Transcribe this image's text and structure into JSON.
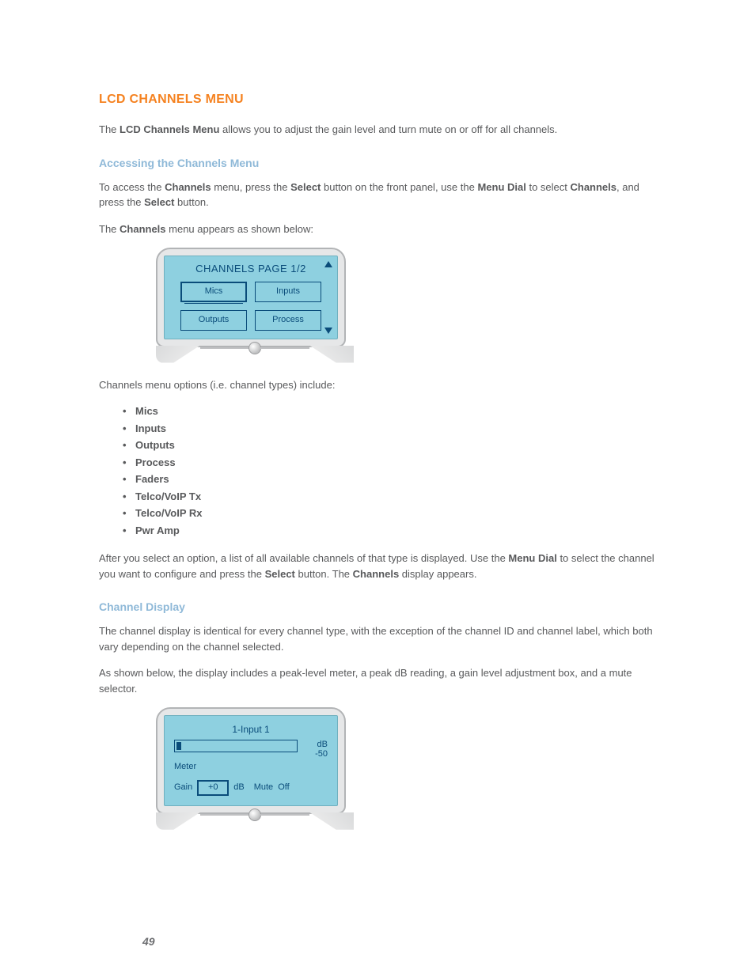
{
  "heading": "LCD CHANNELS MENU",
  "intro": {
    "pre": "The ",
    "bold": "LCD Channels Menu",
    "post": " allows you to adjust the gain level and turn mute on or off for all channels."
  },
  "section_access": {
    "title": "Accessing the Channels Menu",
    "p1": {
      "t0": "To access the ",
      "b1": "Channels",
      "t1": " menu, press the ",
      "b2": "Select",
      "t2": " button on the front panel, use the ",
      "b3": "Menu Dial",
      "t3": " to select ",
      "b4": "Channels",
      "t4": ", and press the ",
      "b5": "Select",
      "t5": " button."
    },
    "p2": {
      "t0": "The ",
      "b1": "Channels",
      "t1": " menu appears as shown below:"
    }
  },
  "lcd1": {
    "title": "CHANNELS PAGE 1/2",
    "buttons": [
      "Mics",
      "Inputs",
      "Outputs",
      "Process"
    ]
  },
  "options_intro": "Channels menu options (i.e. channel types) include:",
  "options": [
    "Mics",
    "Inputs",
    "Outputs",
    "Process",
    "Faders",
    "Telco/VoIP Tx",
    "Telco/VoIP Rx",
    "Pwr Amp"
  ],
  "after_options": {
    "t0": "After you select an option, a list of all available channels of that type is displayed. Use the ",
    "b1": "Menu Dial",
    "t1": " to select the channel you want to configure and press the ",
    "b2": "Select",
    "t2": " button. The ",
    "b3": "Channels",
    "t3": " display appears."
  },
  "section_display": {
    "title": "Channel Display",
    "p1": "The channel display is identical for every channel type, with the exception of the channel ID and channel label, which both vary depending on the channel selected.",
    "p2": "As shown below, the display includes a peak-level meter, a peak dB reading, a gain level adjustment box, and a mute selector."
  },
  "lcd2": {
    "channel_label": "1-Input 1",
    "db_label": "dB",
    "db_value": "-50",
    "meter_label": "Meter",
    "gain_label": "Gain",
    "gain_value": "+0",
    "gain_unit": "dB",
    "mute_label": "Mute",
    "mute_value": "Off"
  },
  "page_number": "49"
}
